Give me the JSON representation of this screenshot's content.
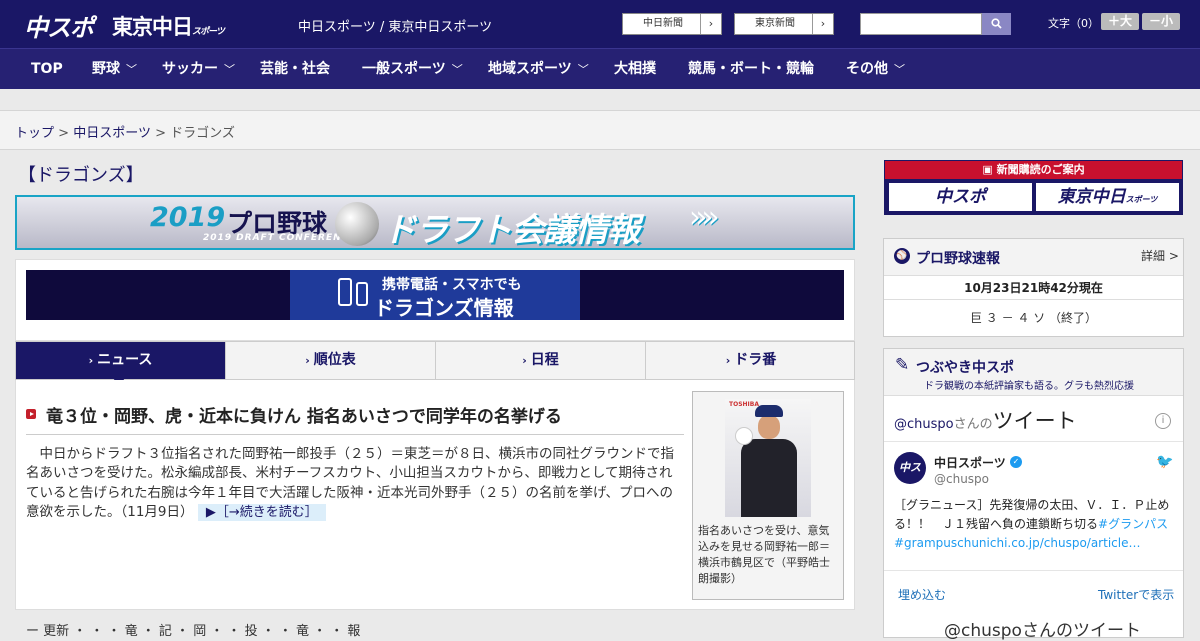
{
  "header": {
    "logo_chunichi": "中スポ",
    "logo_tokyo": "東京中日",
    "logo_tokyo_small": "スポーツ",
    "site_name": "中日スポーツ / 東京中日スポーツ",
    "paper_links": [
      {
        "label": "中日新聞"
      },
      {
        "label": "東京新聞"
      }
    ],
    "search": {
      "placeholder": ""
    },
    "font_size_label": "文字（0）",
    "font_larger": "＋大",
    "font_smaller": "－小"
  },
  "nav": {
    "items": [
      {
        "label": "TOP"
      },
      {
        "label": "野球"
      },
      {
        "label": "サッカー"
      },
      {
        "label": "芸能・社会"
      },
      {
        "label": "一般スポーツ"
      },
      {
        "label": "地域スポーツ"
      },
      {
        "label": "大相撲"
      },
      {
        "label": "競馬・ボート・競輪"
      },
      {
        "label": "その他"
      }
    ]
  },
  "breadcrumb": {
    "top": "トップ",
    "sep": ">",
    "section": "中日スポーツ",
    "current": "ドラゴンズ"
  },
  "main": {
    "page_title": "【ドラゴンズ】",
    "draft_banner": {
      "year": "2019",
      "pro": "プロ野球",
      "main": "ドラフト会議情報",
      "sub": "2019 DRAFT CONFERENCE",
      "arrows": "»»"
    },
    "mobile_banner": {
      "line1": "携帯電話・スマホでも",
      "line2": "ドラゴンズ情報"
    },
    "tabs": [
      {
        "label": "ニュース",
        "active": true
      },
      {
        "label": "順位表"
      },
      {
        "label": "日程"
      },
      {
        "label": "ドラ番"
      }
    ],
    "article": {
      "headline": "竜３位・岡野、虎・近本に負けん 指名あいさつで同学年の名挙げる",
      "body": "　中日からドラフト３位指名された岡野祐一郎投手（２５）＝東芝＝が８日、横浜市の同社グラウンドで指名あいさつを受けた。松永編成部長、米村チーフスカウト、小山担当スカウトから、即戦力として期待されていると告げられた右腕は今年１年目で大活躍した阪神・近本光司外野手（２５）の名前を挙げ、プロへの意欲を示した。（11月9日）",
      "readmore": "▶［→続きを読む］",
      "photo_brand": "TOSHIBA",
      "photo_caption": "指名あいさつを受け、意気込みを見せる岡野祐一郎＝横浜市鶴見区で（平野皓士朗撮影）"
    },
    "second_row": "ー 更新 ・ ・ ・ 竜 ・ 記 ・ 岡 ・ ・ 投 ・ ・ 竜 ・ ・ 報"
  },
  "sidebar": {
    "subscription": {
      "title": "新聞購読のご案内",
      "btn1": "中スポ",
      "btn2": "東京中日",
      "btn2_small": "スポーツ"
    },
    "score": {
      "icon": "⚾",
      "title": "プロ野球速報",
      "more": "詳細 >",
      "time": "10月23日21時42分現在",
      "line": "巨 ３ － ４ ソ （終了）"
    },
    "twitter": {
      "icon": "✎",
      "title": "つぶやき中スポ",
      "subtitle": "ドラ観戦の本紙評論家も語る。グラも熱烈応援",
      "handle": "@chuspo",
      "handle_suffix": "さんの",
      "handle_big": "ツイート",
      "info": "i",
      "avatar": "中スポ",
      "name": "中日スポーツ",
      "verified": "✓",
      "screen_name": "@chuspo",
      "bird": "🐦",
      "text": "［グラニュース］先発復帰の太田、Ｖ．Ｉ．Ｐ止める！！　Ｊ１残留へ負の連鎖断ち切る",
      "hashtag": "#グランパス",
      "link": "#grampuschunichi.co.jp/chuspo/article…",
      "embed": "埋め込む",
      "view": "Twitterで表示",
      "footer": "@chuspoさんのツイート"
    }
  }
}
